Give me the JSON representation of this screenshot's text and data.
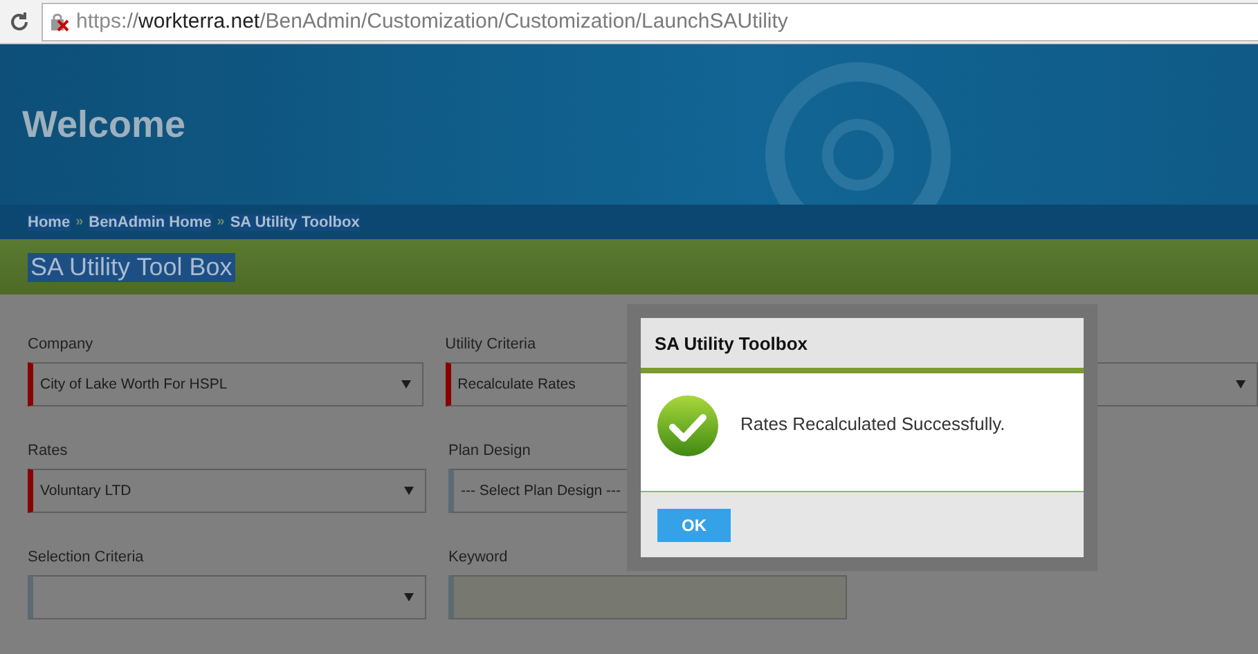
{
  "address_bar": {
    "scheme": "https",
    "separator": "://",
    "host": "workterra.net",
    "path": "/BenAdmin/Customization/Customization/LaunchSAUtility",
    "insecure": true
  },
  "header": {
    "title": "Welcome"
  },
  "breadcrumbs": [
    {
      "label": "Home"
    },
    {
      "label": "BenAdmin Home"
    },
    {
      "label": "SA Utility Toolbox"
    }
  ],
  "breadcrumb_separator": "»",
  "page_title": "SA Utility Tool Box",
  "form_rows": [
    {
      "fields": [
        {
          "label": "Company",
          "kind": "select",
          "value": "City of Lake Worth For HSPL",
          "required": true
        },
        {
          "label": "Utility Criteria",
          "kind": "select",
          "value": "Recalculate Rates",
          "required": true
        },
        {
          "kind": "select"
        }
      ]
    },
    {
      "fields": [
        {
          "label": "Rates",
          "kind": "select",
          "value": "Voluntary LTD",
          "required": true
        },
        {
          "label": "Plan Design",
          "kind": "select",
          "value": "--- Select Plan Design ---",
          "required": false
        }
      ]
    },
    {
      "fields": [
        {
          "label": "Selection Criteria",
          "kind": "select",
          "required": false
        },
        {
          "label": "Keyword",
          "kind": "text",
          "required": false
        }
      ]
    }
  ],
  "dialog": {
    "title": "SA Utility Toolbox",
    "message": "Rates Recalculated Successfully.",
    "buttons": [
      "OK"
    ]
  }
}
